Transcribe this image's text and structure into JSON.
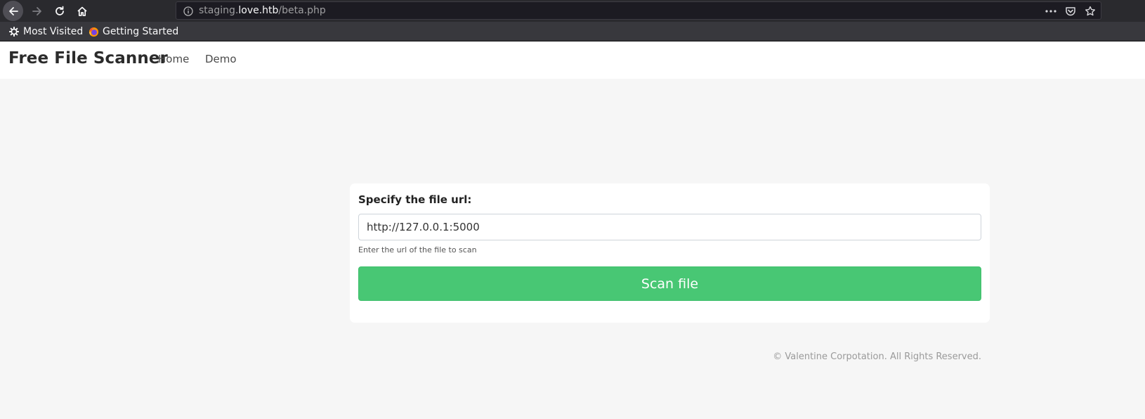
{
  "browser": {
    "url_prefix": "staging.",
    "url_host": "love.htb",
    "url_path": "/beta.php",
    "bookmarks": [
      {
        "label": "Most Visited",
        "icon": "gear-icon"
      },
      {
        "label": "Getting Started",
        "icon": "firefox-icon"
      }
    ]
  },
  "navbar": {
    "brand": "Free File Scanner",
    "links": [
      "Home",
      "Demo"
    ]
  },
  "form": {
    "label": "Specify the file url:",
    "input_value": "http://127.0.0.1:5000",
    "help": "Enter the url of the file to scan",
    "button": "Scan file"
  },
  "footer": {
    "text": "© Valentine Corpotation. All Rights Reserved."
  },
  "colors": {
    "button": "#48c774",
    "chrome": "#2a2a2e",
    "page_bg": "#f6f6f6"
  }
}
